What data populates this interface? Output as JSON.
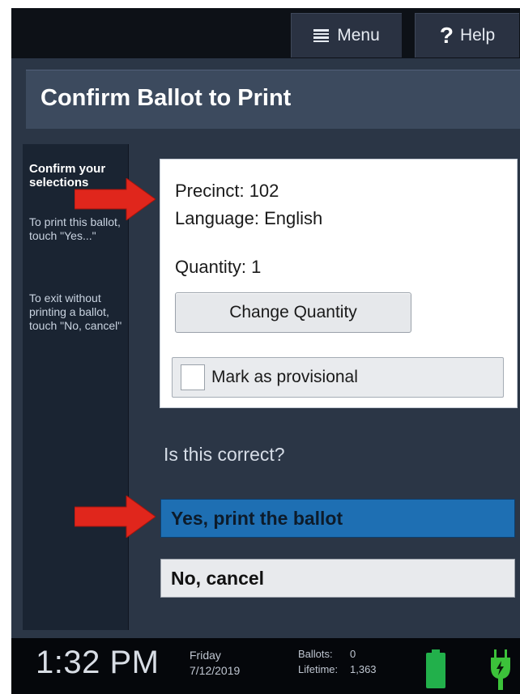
{
  "topbar": {
    "menu_label": "Menu",
    "help_label": "Help",
    "help_glyph": "?"
  },
  "title": "Confirm Ballot to Print",
  "sidebar": {
    "heading": "Confirm your selections",
    "para1": "To print this ballot, touch \"Yes...\"",
    "para2": "To exit without printing a ballot, touch \"No, cancel\""
  },
  "panel": {
    "precinct": "Precinct: 102",
    "language": "Language: English",
    "quantity": "Quantity: 1",
    "change_quantity_label": "Change Quantity",
    "provisional_label": "Mark as provisional",
    "provisional_checked": false
  },
  "question": "Is this correct?",
  "yes_label": "Yes, print the ballot",
  "no_label": "No, cancel",
  "status": {
    "time": "1:32 PM",
    "day": "Friday",
    "date": "7/12/2019",
    "ballots_label": "Ballots:",
    "ballots_value": "0",
    "lifetime_label": "Lifetime:",
    "lifetime_value": "1,363"
  },
  "colors": {
    "accent_blue": "#1e6fb3",
    "arrow_red": "#e0261c",
    "battery_green": "#22b04b",
    "plug_green": "#3cc23a"
  },
  "icons": [
    "menu-icon",
    "help-icon",
    "arrow-icon",
    "battery-icon",
    "plug-icon"
  ]
}
